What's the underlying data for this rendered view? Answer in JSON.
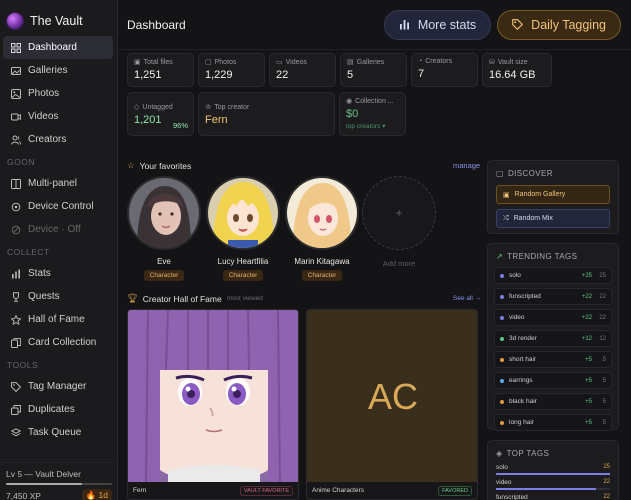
{
  "app": {
    "title": "The Vault"
  },
  "sidebar": {
    "main_items": [
      {
        "label": "Dashboard",
        "icon": "dashboard-icon",
        "active": true
      },
      {
        "label": "Galleries",
        "icon": "galleries-icon"
      },
      {
        "label": "Photos",
        "icon": "photo-icon"
      },
      {
        "label": "Videos",
        "icon": "video-icon"
      },
      {
        "label": "Creators",
        "icon": "creators-icon"
      }
    ],
    "goon_section": "GOON",
    "goon_items": [
      {
        "label": "Multi-panel",
        "icon": "multi-panel-icon"
      },
      {
        "label": "Device Control",
        "icon": "device-icon"
      },
      {
        "label": "Device · Off",
        "icon": "device-off-icon",
        "disabled": true
      }
    ],
    "collect_section": "COLLECT",
    "collect_items": [
      {
        "label": "Stats",
        "icon": "stats-icon"
      },
      {
        "label": "Quests",
        "icon": "trophy-icon"
      },
      {
        "label": "Hall of Fame",
        "icon": "star-icon"
      },
      {
        "label": "Card Collection",
        "icon": "cards-icon"
      }
    ],
    "tools_section": "TOOLS",
    "tools_items": [
      {
        "label": "Tag Manager",
        "icon": "tag-icon"
      },
      {
        "label": "Duplicates",
        "icon": "duplicates-icon"
      },
      {
        "label": "Task Queue",
        "icon": "task-queue-icon"
      }
    ],
    "level": {
      "text": "Lv 5 — Vault Delver",
      "xp": "7,450 XP",
      "streak": "1d",
      "progress": 0.72
    }
  },
  "header": {
    "title": "Dashboard",
    "more_stats": "More stats",
    "daily_tagging": "Daily Tagging"
  },
  "stats": {
    "total_files": {
      "label": "Total files",
      "value": "1,251"
    },
    "photos": {
      "label": "Photos",
      "value": "1,229"
    },
    "videos": {
      "label": "Videos",
      "value": "22"
    },
    "galleries": {
      "label": "Galleries",
      "value": "5"
    },
    "creators": {
      "label": "Creators",
      "value": "7"
    },
    "vault_size": {
      "label": "Vault size",
      "value": "16.64 GB"
    },
    "untagged": {
      "label": "Untagged",
      "value": "1,201",
      "pct": "96%"
    },
    "top_creator": {
      "label": "Top creator",
      "value": "Fern"
    },
    "collection": {
      "label": "Collection ...",
      "value": "$0",
      "sub": "top creators ▾"
    }
  },
  "favorites": {
    "title": "Your favorites",
    "manage": "manage",
    "items": [
      {
        "name": "Eve",
        "badge": "Character"
      },
      {
        "name": "Lucy Heartfilia",
        "badge": "Character"
      },
      {
        "name": "Marin Kitagawa",
        "badge": "Character"
      }
    ],
    "add_more": "Add more",
    "add_symbol": "+"
  },
  "hall_of_fame": {
    "title": "Creator Hall of Fame",
    "subtitle": "most viewed",
    "see_all": "See all →",
    "cards": [
      {
        "name": "Fern",
        "tag": "VAULT FAVORITE"
      },
      {
        "name": "Anime Characters",
        "initials": "AC",
        "tag": "FAVORED"
      }
    ]
  },
  "discover": {
    "title": "DISCOVER",
    "random_gallery": "Random Gallery",
    "random_mix": "Random Mix"
  },
  "trending": {
    "title": "TRENDING TAGS",
    "rows": [
      {
        "name": "solo",
        "delta": "+25",
        "count": "25",
        "color": "#7c7fe3"
      },
      {
        "name": "funscripted",
        "delta": "+22",
        "count": "22",
        "color": "#7c7fe3"
      },
      {
        "name": "video",
        "delta": "+22",
        "count": "22",
        "color": "#7c7fe3"
      },
      {
        "name": "3d render",
        "delta": "+12",
        "count": "12",
        "color": "#59c97f"
      },
      {
        "name": "short hair",
        "delta": "+5",
        "count": "5",
        "color": "#e09a40"
      },
      {
        "name": "earrings",
        "delta": "+5",
        "count": "5",
        "color": "#5aa9e6"
      },
      {
        "name": "black hair",
        "delta": "+5",
        "count": "5",
        "color": "#e09a40"
      },
      {
        "name": "long hair",
        "delta": "+5",
        "count": "5",
        "color": "#e09a40"
      }
    ]
  },
  "top_tags": {
    "title": "TOP TAGS",
    "rows": [
      {
        "name": "solo",
        "count": "25",
        "fill": 1.0
      },
      {
        "name": "video",
        "count": "22",
        "fill": 0.88
      },
      {
        "name": "funscripted",
        "count": "22",
        "fill": 0.88
      }
    ]
  },
  "colors": {
    "accent_gold": "#f1c477",
    "accent_blue": "#8b8fe8",
    "green": "#59c97f"
  }
}
